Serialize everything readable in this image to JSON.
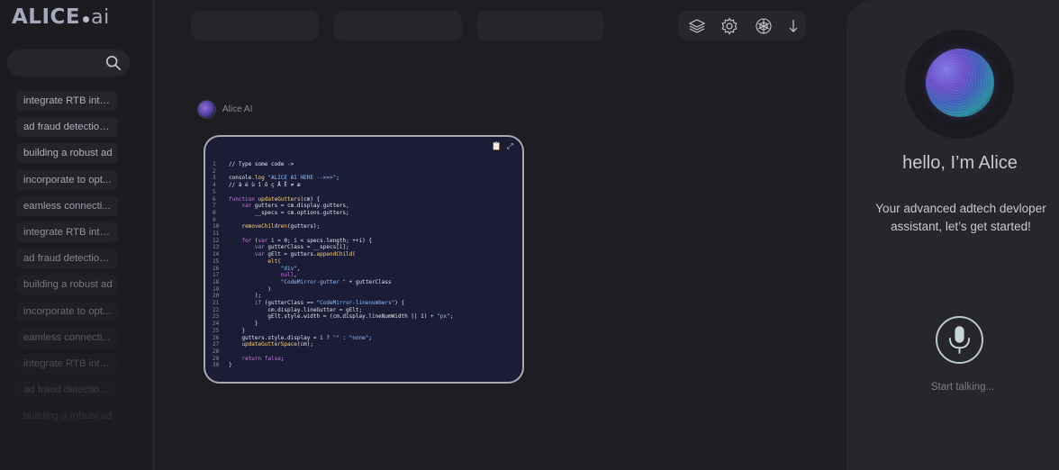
{
  "app": {
    "logo_main": "ALICE",
    "logo_ai": "ai"
  },
  "search": {
    "placeholder": ""
  },
  "history": [
    {
      "label": "integrate  RTB into...",
      "opacity": 1.0
    },
    {
      "label": "ad fraud detection ...",
      "opacity": 1.0
    },
    {
      "label": "building a robust ad",
      "opacity": 1.0
    },
    {
      "label": "incorporate to opt...",
      "opacity": 0.95
    },
    {
      "label": "eamless connecti...",
      "opacity": 0.88
    },
    {
      "label": "integrate  RTB into...",
      "opacity": 0.8
    },
    {
      "label": "ad fraud detection ...",
      "opacity": 0.72
    },
    {
      "label": "building a robust ad",
      "opacity": 0.62
    },
    {
      "label": "incorporate to opt...",
      "opacity": 0.52
    },
    {
      "label": "eamless connecti...",
      "opacity": 0.42
    },
    {
      "label": "integrate  RTB into...",
      "opacity": 0.32
    },
    {
      "label": "ad fraud detection ...",
      "opacity": 0.22
    },
    {
      "label": "building a robust ad",
      "opacity": 0.14
    }
  ],
  "toolbar": {
    "icons": [
      "layers-icon",
      "settings-gear-icon",
      "openai-knot-icon",
      "arrow-down-icon"
    ]
  },
  "message": {
    "author": "Alice AI"
  },
  "code": {
    "lines": [
      "// Type some code ->",
      "",
      "console.log \"ALICE AI HERE -->>>\";",
      "// à é ù î ô ç Å Ë ≠ æ",
      "",
      "function updateGutters(cm) {",
      "    var gutters = cm.display.gutters,",
      "        __specs = cm.options.gutters;",
      "",
      "    removeChildren(gutters);",
      "",
      "    for (var i = 0; i < specs.length; ++i) {",
      "        var gutterClass = __specs[i];",
      "        var gElt = gutters.appendChild(",
      "            elt(",
      "                \"div\",",
      "                null,",
      "                \"CodeMirror-gutter \" + gutterClass",
      "            )",
      "        );",
      "        if (gutterClass == \"CodeMirror-linenumbers\") {",
      "            cm.display.lineGutter = gElt;",
      "            gElt.style.width = (cm.display.lineNumWidth || 1) + \"px\";",
      "        }",
      "    }",
      "    gutters.style.display = i ? \"\" : \"none\";",
      "    updateGutterSpace(cm);",
      "",
      "    return false;",
      "}"
    ]
  },
  "assistant": {
    "greeting": "hello, I’m Alice",
    "intro": "Your advanced adtech devloper assistant, let’s get started!",
    "start_talking": "Start talking..."
  },
  "colors": {
    "background": "#1d1d22",
    "panel": "#26262b",
    "code_bg": "#1b1d36",
    "keyword": "#c678dd",
    "string": "#8ec1ff",
    "function": "#ffd47a"
  }
}
